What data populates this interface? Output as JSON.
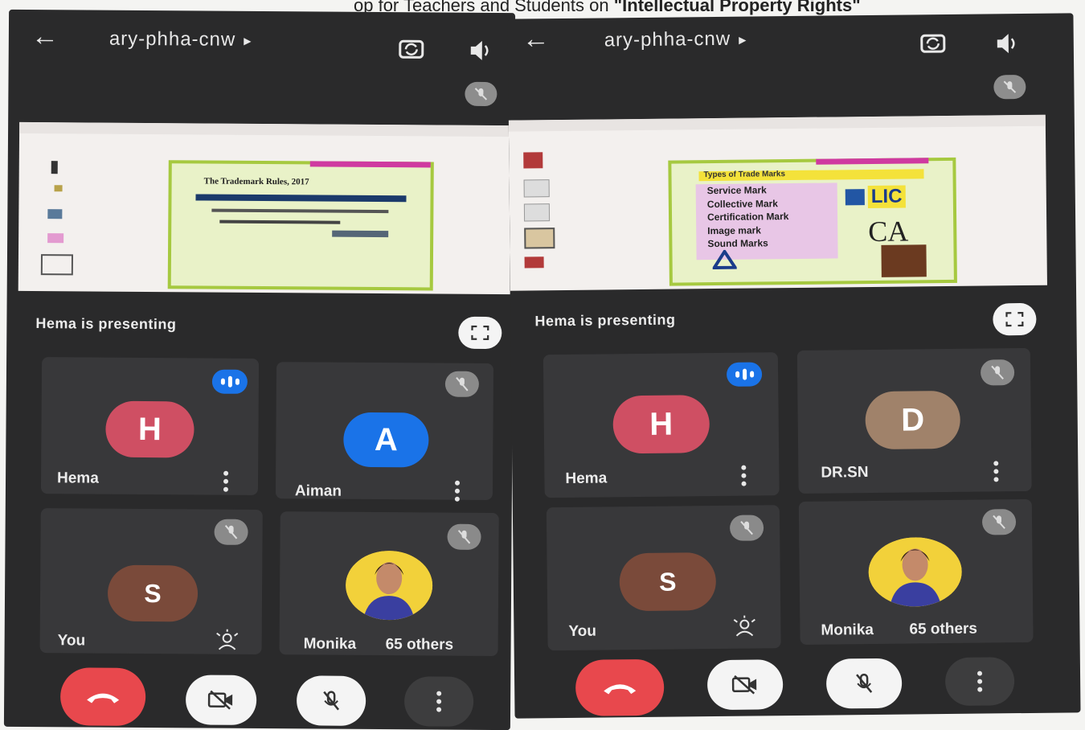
{
  "banner": {
    "prefix": "op for Teachers and Students on",
    "emphasis": "\"Intellectual Property Rights\""
  },
  "left": {
    "meeting_code": "ary-phha-cnw",
    "slide": {
      "title": "The Trademark Rules, 2017"
    },
    "presenting_text": "Hema is presenting",
    "tiles": [
      {
        "initial": "H",
        "name": "Hema",
        "color": "#cf4f63"
      },
      {
        "initial": "A",
        "name": "Aiman",
        "color": "#1a73e8"
      },
      {
        "initial": "S",
        "name": "You",
        "color": "#7a4a3a"
      },
      {
        "name": "Monika",
        "others": "65 others"
      }
    ]
  },
  "right": {
    "meeting_code": "ary-phha-cnw",
    "slide": {
      "heading": "Types of Trade Marks",
      "items": [
        "Service Mark",
        "Collective Mark",
        "Certification Mark",
        "Image mark",
        "Sound Marks"
      ],
      "logo_lic": "LIC",
      "logo_ca": "CA"
    },
    "presenting_text": "Hema is presenting",
    "tiles": [
      {
        "initial": "H",
        "name": "Hema",
        "color": "#cf4f63"
      },
      {
        "initial": "D",
        "name": "DR.SN",
        "color": "#a0826a"
      },
      {
        "initial": "S",
        "name": "You",
        "color": "#7a4a3a"
      },
      {
        "name": "Monika",
        "others": "65 others"
      }
    ]
  },
  "icons": [
    "back-arrow-icon",
    "rotate-camera-icon",
    "speaker-icon",
    "mic-off-icon",
    "fullscreen-icon",
    "more-vert-icon",
    "hand-raise-icon",
    "end-call-icon",
    "camera-off-icon"
  ],
  "colors": {
    "background": "#2a2a2b",
    "tile": "#38383a",
    "end_call": "#e8484d",
    "speaking": "#1a73e8"
  }
}
